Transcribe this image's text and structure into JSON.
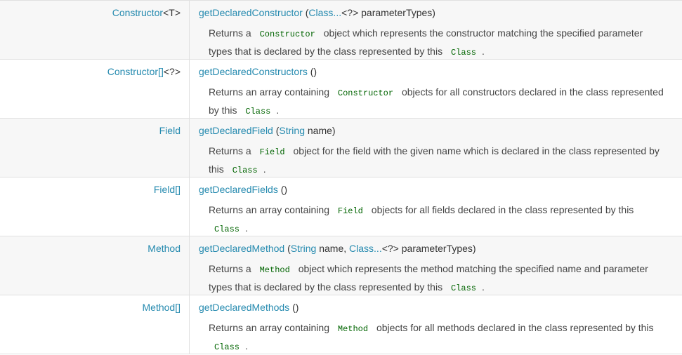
{
  "colors": {
    "link": "#258aaf",
    "code": "#006400",
    "row_alt": "#f7f7f7",
    "border": "#e0e0e0"
  },
  "rows": [
    {
      "type": [
        {
          "text": "Constructor",
          "link": true
        },
        {
          "text": "<T>",
          "link": false
        }
      ],
      "sig": [
        {
          "text": "getDeclaredConstructor",
          "link": true
        },
        {
          "text": " (",
          "link": false
        },
        {
          "text": "Class...",
          "link": true
        },
        {
          "text": "<?> parameterTypes)",
          "link": false
        }
      ],
      "desc": [
        {
          "text": "Returns a ",
          "code": false
        },
        {
          "text": "Constructor",
          "code": true
        },
        {
          "text": " object which represents the constructor matching the specified parameter types that is declared by the class represented by this ",
          "code": false
        },
        {
          "text": "Class",
          "code": true
        },
        {
          "text": ".",
          "code": false
        }
      ]
    },
    {
      "type": [
        {
          "text": "Constructor[]",
          "link": true
        },
        {
          "text": "<?>",
          "link": false
        }
      ],
      "sig": [
        {
          "text": "getDeclaredConstructors",
          "link": true
        },
        {
          "text": " ()",
          "link": false
        }
      ],
      "desc": [
        {
          "text": "Returns an array containing ",
          "code": false
        },
        {
          "text": "Constructor",
          "code": true
        },
        {
          "text": " objects for all constructors declared in the class represented by this ",
          "code": false
        },
        {
          "text": "Class",
          "code": true
        },
        {
          "text": ".",
          "code": false
        }
      ]
    },
    {
      "type": [
        {
          "text": "Field",
          "link": true
        }
      ],
      "sig": [
        {
          "text": "getDeclaredField",
          "link": true
        },
        {
          "text": " (",
          "link": false
        },
        {
          "text": "String",
          "link": true
        },
        {
          "text": " name)",
          "link": false
        }
      ],
      "desc": [
        {
          "text": "Returns a ",
          "code": false
        },
        {
          "text": "Field",
          "code": true
        },
        {
          "text": " object for the field with the given name which is declared in the class represented by this ",
          "code": false
        },
        {
          "text": "Class",
          "code": true
        },
        {
          "text": ".",
          "code": false
        }
      ]
    },
    {
      "type": [
        {
          "text": "Field[]",
          "link": true
        }
      ],
      "sig": [
        {
          "text": "getDeclaredFields",
          "link": true
        },
        {
          "text": " ()",
          "link": false
        }
      ],
      "desc": [
        {
          "text": "Returns an array containing ",
          "code": false
        },
        {
          "text": "Field",
          "code": true
        },
        {
          "text": " objects for all fields declared in the class represented by this ",
          "code": false
        },
        {
          "text": "Class",
          "code": true
        },
        {
          "text": ".",
          "code": false
        }
      ]
    },
    {
      "type": [
        {
          "text": "Method",
          "link": true
        }
      ],
      "sig": [
        {
          "text": "getDeclaredMethod",
          "link": true
        },
        {
          "text": " (",
          "link": false
        },
        {
          "text": "String",
          "link": true
        },
        {
          "text": " name, ",
          "link": false
        },
        {
          "text": "Class...",
          "link": true
        },
        {
          "text": "<?> parameterTypes)",
          "link": false
        }
      ],
      "desc": [
        {
          "text": "Returns a ",
          "code": false
        },
        {
          "text": "Method",
          "code": true
        },
        {
          "text": " object which represents the method matching the specified name and parameter types that is declared by the class represented by this ",
          "code": false
        },
        {
          "text": "Class",
          "code": true
        },
        {
          "text": ".",
          "code": false
        }
      ]
    },
    {
      "type": [
        {
          "text": "Method[]",
          "link": true
        }
      ],
      "sig": [
        {
          "text": "getDeclaredMethods",
          "link": true
        },
        {
          "text": " ()",
          "link": false
        }
      ],
      "desc": [
        {
          "text": "Returns an array containing ",
          "code": false
        },
        {
          "text": "Method",
          "code": true
        },
        {
          "text": " objects for all methods declared in the class represented by this ",
          "code": false
        },
        {
          "text": "Class",
          "code": true
        },
        {
          "text": ".",
          "code": false
        }
      ]
    }
  ]
}
